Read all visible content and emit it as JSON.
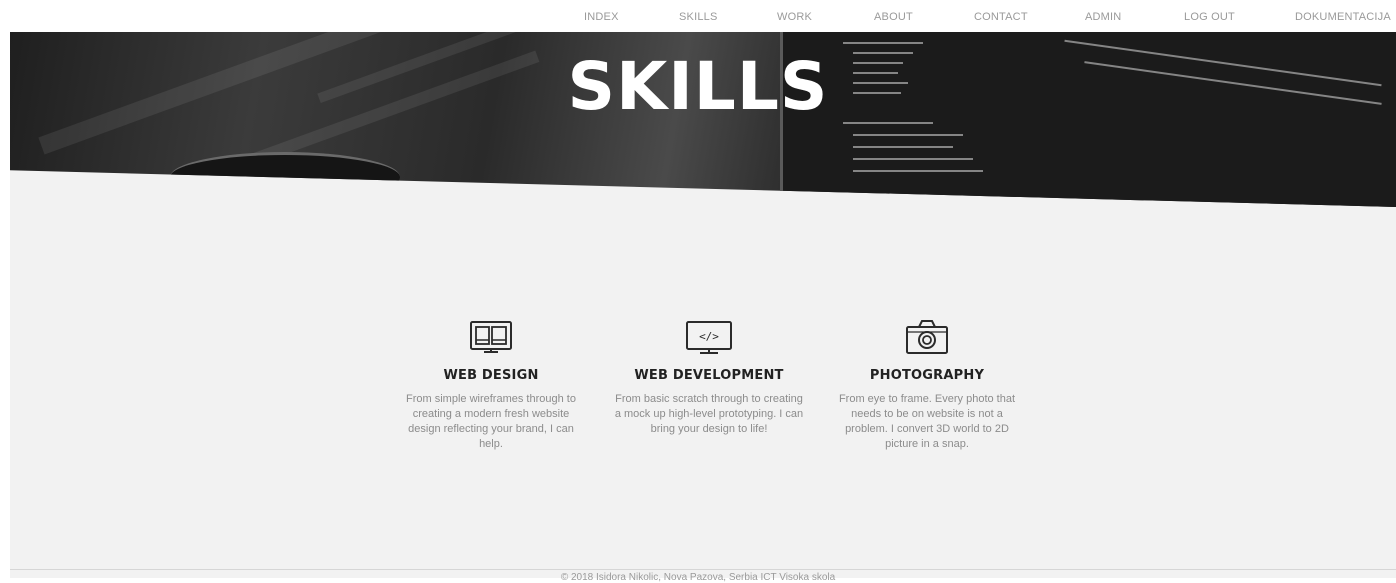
{
  "nav": {
    "items": [
      {
        "label": "INDEX"
      },
      {
        "label": "SKILLS"
      },
      {
        "label": "WORK"
      },
      {
        "label": "ABOUT"
      },
      {
        "label": "CONTACT"
      },
      {
        "label": "ADMIN"
      },
      {
        "label": "LOG OUT"
      },
      {
        "label": "DOKUMENTACIJA"
      }
    ]
  },
  "hero": {
    "title": "SKILLS"
  },
  "skills": [
    {
      "icon": "devices-icon",
      "title": "WEB DESIGN",
      "description": "From simple wireframes through to creating a modern fresh website design reflecting your brand, I can help."
    },
    {
      "icon": "code-monitor-icon",
      "title": "WEB DEVELOPMENT",
      "description": "From basic scratch through to creating a mock up high-level prototyping. I can bring your design to life!"
    },
    {
      "icon": "camera-icon",
      "title": "PHOTOGRAPHY",
      "description": "From eye to frame. Every photo that needs to be on website is not a problem. I convert 3D world to 2D picture in a snap."
    }
  ],
  "footer": {
    "text": "© 2018 Isidora Nikolic, Nova Pazova, Serbia ICT Visoka skola"
  },
  "colors": {
    "background": "#f2f2f2",
    "nav_text": "#9a9a9a",
    "heading": "#222222",
    "body_text": "#8c8c8c"
  }
}
